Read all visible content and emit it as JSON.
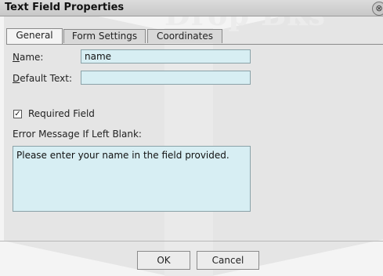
{
  "window": {
    "title": "Text Field Properties",
    "close_glyph": "⊗"
  },
  "tabs": [
    {
      "label": "General",
      "active": true
    },
    {
      "label": "Form Settings",
      "active": false
    },
    {
      "label": "Coordinates",
      "active": false
    }
  ],
  "form": {
    "name_label_first": "N",
    "name_label_rest": "ame:",
    "name_value": "name",
    "default_label_first": "D",
    "default_label_rest": "efault Text:",
    "default_value": "",
    "required_label": "Required Field",
    "required_checked": true,
    "error_label": "Error Message If Left Blank:",
    "error_value": "Please enter your name in the field provided."
  },
  "buttons": {
    "ok": "OK",
    "cancel": "Cancel"
  },
  "watermark": {
    "text": "Drop Bks",
    "color": "#e5e5e5"
  },
  "colors": {
    "field_bg": "#d7eef3",
    "titlebar": "#d0d0d0"
  }
}
